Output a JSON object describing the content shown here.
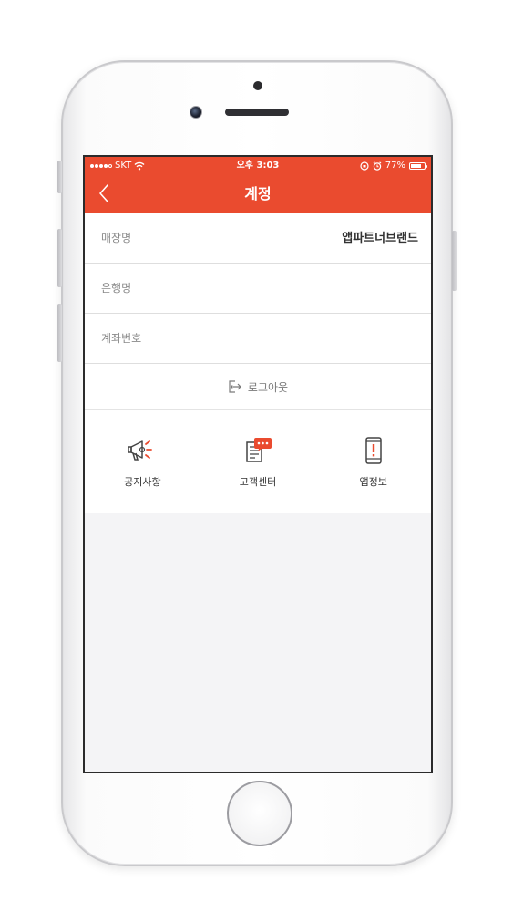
{
  "status_bar": {
    "carrier": "SKT",
    "time": "오후 3:03",
    "battery": "77%",
    "battery_level": 0.77
  },
  "nav": {
    "title": "계정",
    "back_icon": "chevron-left-icon"
  },
  "account_rows": [
    {
      "label": "매장명",
      "value": "앱파트너브랜드"
    },
    {
      "label": "은행명",
      "value": ""
    },
    {
      "label": "계좌번호",
      "value": ""
    }
  ],
  "logout": {
    "label": "로그아웃",
    "icon": "logout-icon"
  },
  "menu": [
    {
      "label": "공지사항",
      "icon": "megaphone-icon"
    },
    {
      "label": "고객센터",
      "icon": "customer-center-icon"
    },
    {
      "label": "앱정보",
      "icon": "app-info-icon"
    }
  ],
  "colors": {
    "accent": "#ea4b2f",
    "screen_bg": "#f4f4f6",
    "row_bg": "#ffffff"
  }
}
